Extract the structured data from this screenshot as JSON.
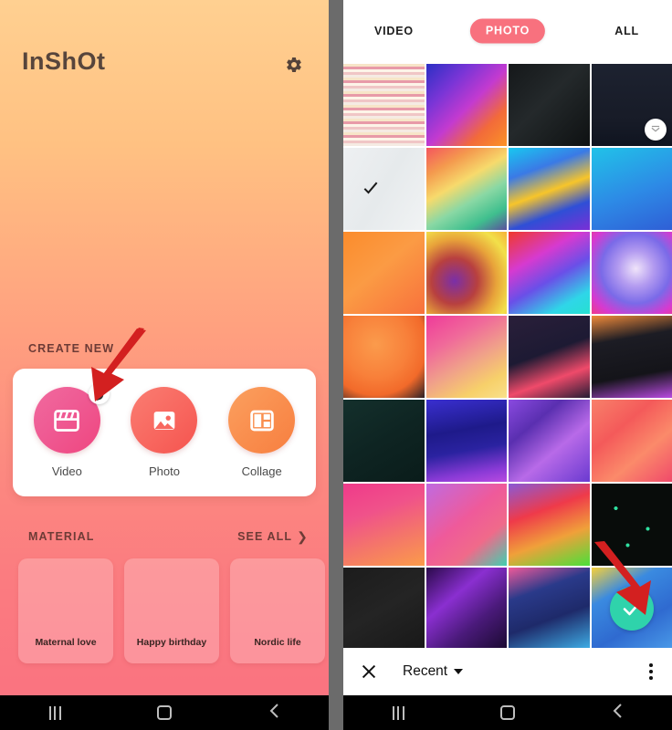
{
  "left_phone": {
    "app_title": "InShOt",
    "settings_icon": "gear-icon",
    "create_new": {
      "section_label": "CREATE NEW",
      "items": [
        {
          "label": "Video",
          "icon": "clapperboard-icon",
          "color": "#ef5a93"
        },
        {
          "label": "Photo",
          "icon": "picture-icon",
          "color": "#f8675f"
        },
        {
          "label": "Collage",
          "icon": "collage-icon",
          "color": "#f98d4d"
        }
      ]
    },
    "material": {
      "section_label": "MATERIAL",
      "see_all_label": "SEE ALL",
      "see_all_chevron": "chevron-right-icon",
      "cards": [
        {
          "title": "Maternal love"
        },
        {
          "title": "Happy birthday"
        },
        {
          "title": "Nordic life"
        }
      ]
    },
    "annotation": {
      "arrow": "red-arrow-down-left",
      "color": "#d32020"
    },
    "nav_bar": {
      "recents": "recents-icon",
      "home": "home-icon",
      "back": "back-icon"
    }
  },
  "right_phone": {
    "tabs": [
      {
        "label": "VIDEO",
        "selected": false
      },
      {
        "label": "PHOTO",
        "selected": true
      },
      {
        "label": "ALL",
        "selected": false
      }
    ],
    "tab_selected_color": "#f8717e",
    "gallery": {
      "columns": 4,
      "thumbnails": [
        {
          "id": 1,
          "style": "rainbow-motion-blur-stripes"
        },
        {
          "id": 2,
          "style": "purple-orange-phone-edge"
        },
        {
          "id": 3,
          "style": "dark-neon-green-lines"
        },
        {
          "id": 4,
          "style": "dark-navy-curve",
          "badge": "collapse-icon"
        },
        {
          "id": 5,
          "style": "white-crystal-lines",
          "checkmark": "dark-check"
        },
        {
          "id": 6,
          "style": "pastel-ribbon-gradient"
        },
        {
          "id": 7,
          "style": "blue-yellow-blobs"
        },
        {
          "id": 8,
          "style": "cyan-blue-gradient"
        },
        {
          "id": 9,
          "style": "orange-diagonal-gradient"
        },
        {
          "id": 10,
          "style": "yellow-purple-mesh"
        },
        {
          "id": 11,
          "style": "red-violet-cyan-mesh"
        },
        {
          "id": 12,
          "style": "blue-pink-aurora"
        },
        {
          "id": 13,
          "style": "orange-soft-shapes"
        },
        {
          "id": 14,
          "style": "pink-yellow-soft-gradient"
        },
        {
          "id": 15,
          "style": "dark-purple-wave"
        },
        {
          "id": 16,
          "style": "dark-tech-orange-corner"
        },
        {
          "id": 17,
          "style": "dark-teal-texture"
        },
        {
          "id": 18,
          "style": "navy-violet-waves"
        },
        {
          "id": 19,
          "style": "purple-hexagons"
        },
        {
          "id": 20,
          "style": "coral-diamonds"
        },
        {
          "id": 21,
          "style": "pink-orange-gradient"
        },
        {
          "id": 22,
          "style": "pink-teal-gradient"
        },
        {
          "id": 23,
          "style": "green-red-rainbow"
        },
        {
          "id": 24,
          "style": "matrix-green-squares"
        },
        {
          "id": 25,
          "style": "dark-yellow-triangles"
        },
        {
          "id": 26,
          "style": "purple-magenta-blob"
        },
        {
          "id": 27,
          "style": "navy-cyan-bubbles"
        },
        {
          "id": 28,
          "style": "blue-abstract",
          "selected": true,
          "select_color": "#2fd3ab"
        },
        {
          "id": 29,
          "style": "navy-dark-strip"
        },
        {
          "id": 30,
          "style": "dark-gold-strip"
        },
        {
          "id": 31,
          "style": "cyan-dark-strip"
        },
        {
          "id": 32,
          "style": "dark-hexagon-strip"
        }
      ]
    },
    "annotation": {
      "arrow": "red-arrow-down-right",
      "color": "#d32020"
    },
    "bottom_bar": {
      "close_icon": "close-icon",
      "album_label": "Recent",
      "album_caret": "caret-down-icon",
      "overflow_icon": "kebab-menu-icon"
    },
    "nav_bar": {
      "recents": "recents-icon",
      "home": "home-icon",
      "back": "back-icon"
    }
  }
}
